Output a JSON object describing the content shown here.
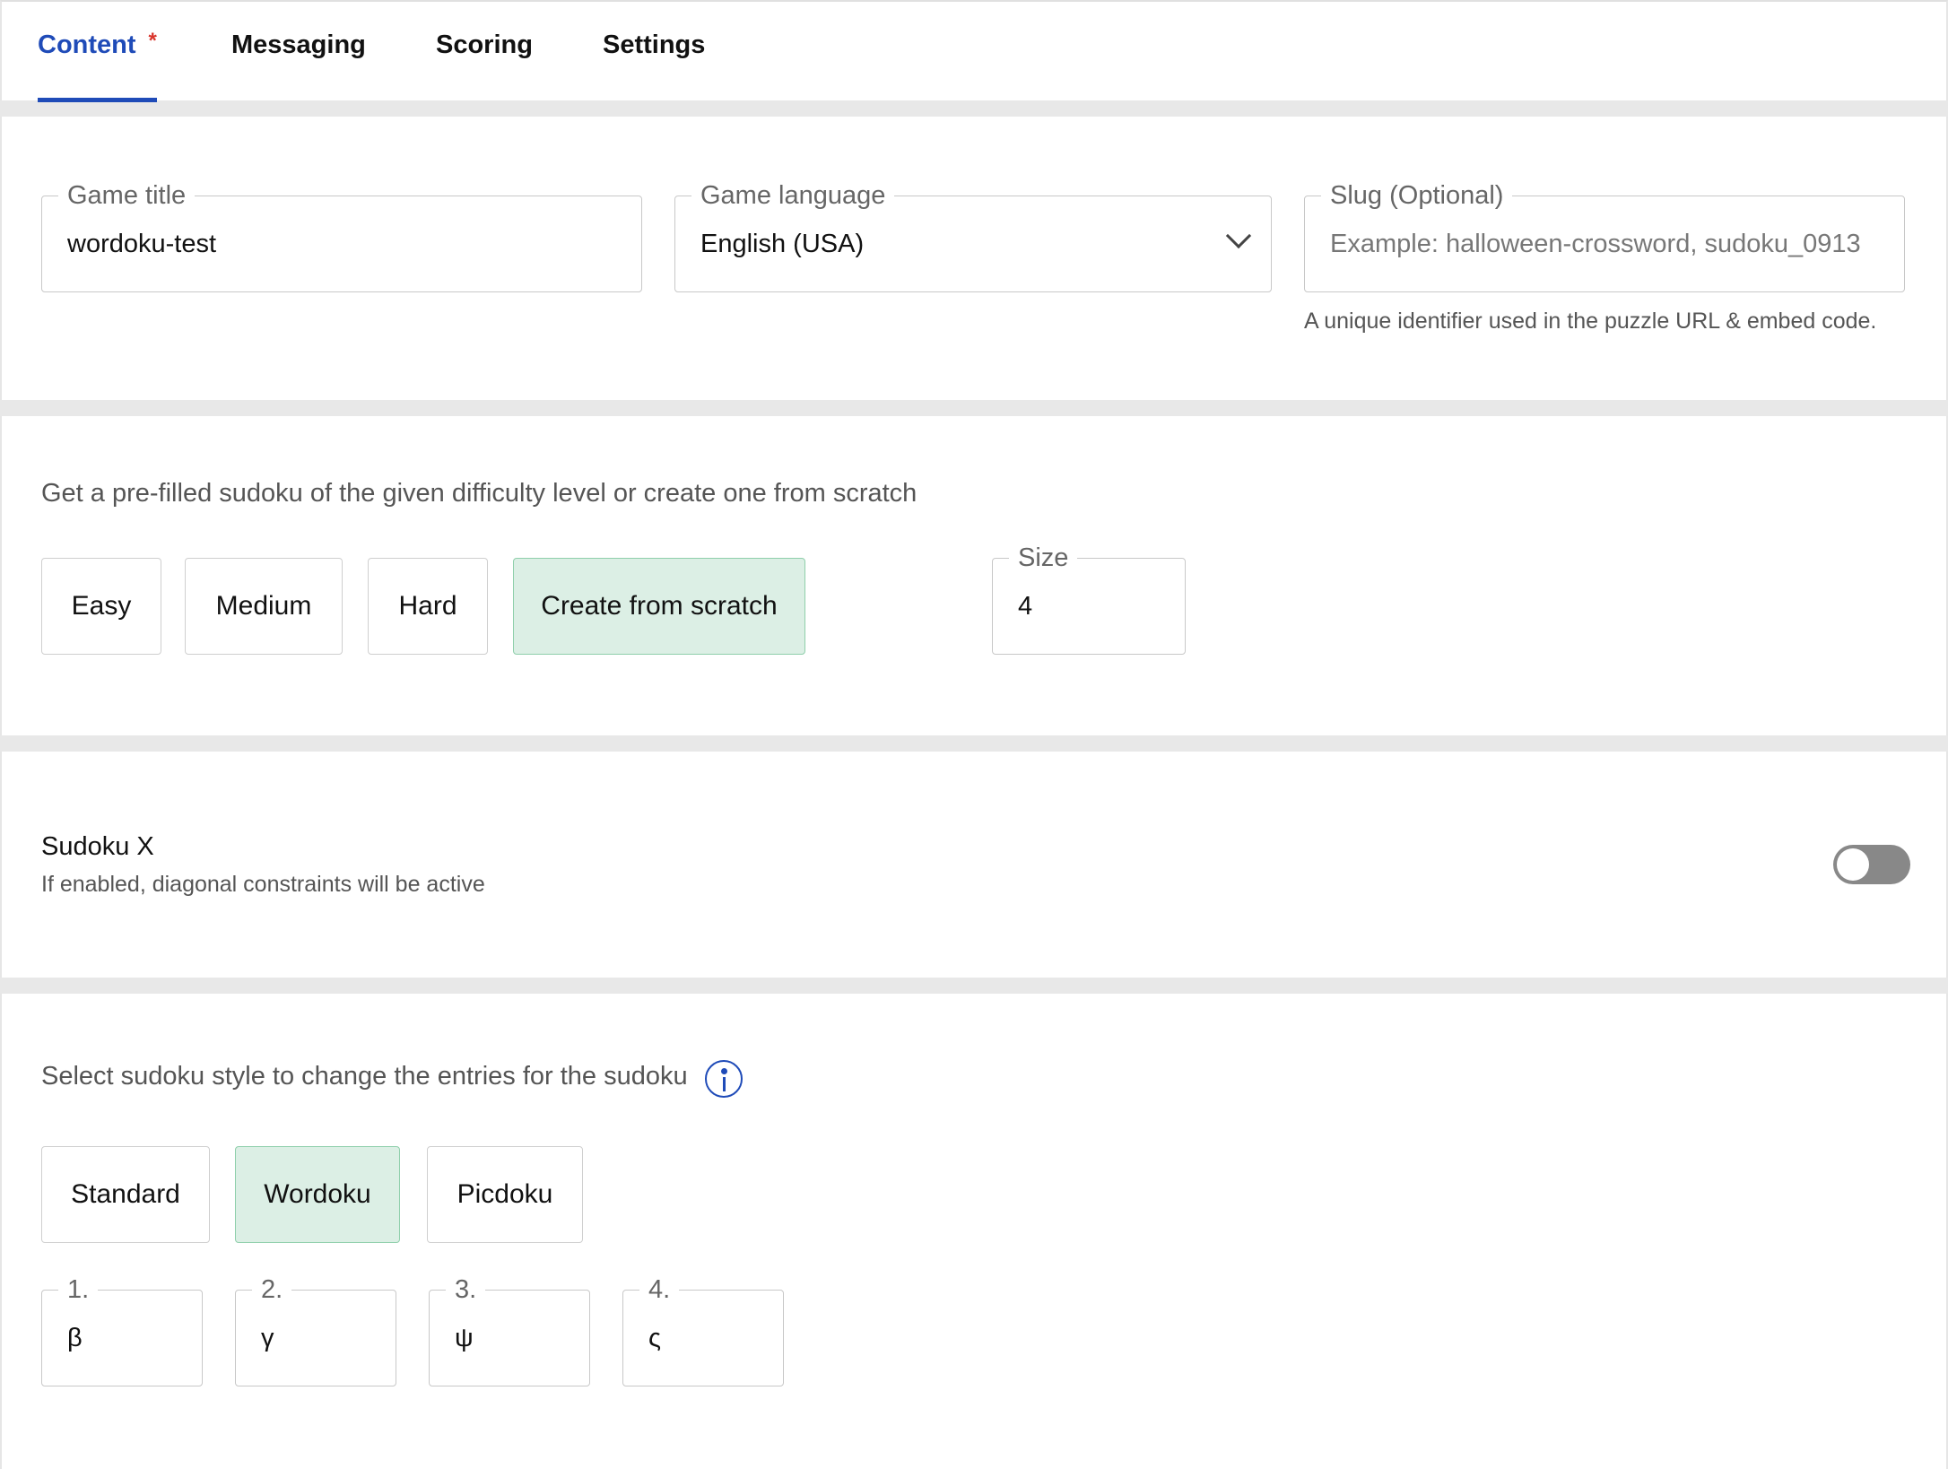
{
  "tabs": [
    {
      "label": "Content",
      "required_mark": "*",
      "active": true
    },
    {
      "label": "Messaging",
      "active": false
    },
    {
      "label": "Scoring",
      "active": false
    },
    {
      "label": "Settings",
      "active": false
    }
  ],
  "basics": {
    "game_title": {
      "label": "Game title",
      "value": "wordoku-test"
    },
    "game_language": {
      "label": "Game language",
      "value": "English (USA)"
    },
    "slug": {
      "label": "Slug (Optional)",
      "placeholder": "Example: halloween-crossword, sudoku_0913",
      "helper": "A unique identifier used in the puzzle URL & embed code."
    }
  },
  "difficulty": {
    "prompt": "Get a pre-filled sudoku of the given difficulty level or create one from scratch",
    "options": [
      "Easy",
      "Medium",
      "Hard",
      "Create from scratch"
    ],
    "selected": "Create from scratch",
    "size": {
      "label": "Size",
      "value": "4"
    }
  },
  "sudoku_x": {
    "title": "Sudoku X",
    "description": "If enabled, diagonal constraints will be active",
    "enabled": false
  },
  "style": {
    "prompt": "Select sudoku style to change the entries for the sudoku",
    "options": [
      "Standard",
      "Wordoku",
      "Picdoku"
    ],
    "selected": "Wordoku",
    "entries": [
      {
        "label": "1.",
        "value": "β"
      },
      {
        "label": "2.",
        "value": "γ"
      },
      {
        "label": "3.",
        "value": "ψ"
      },
      {
        "label": "4.",
        "value": "ς"
      }
    ]
  },
  "colors": {
    "accent": "#1f4bb8",
    "selected_bg": "#dcefe5",
    "required": "#d9342b"
  }
}
